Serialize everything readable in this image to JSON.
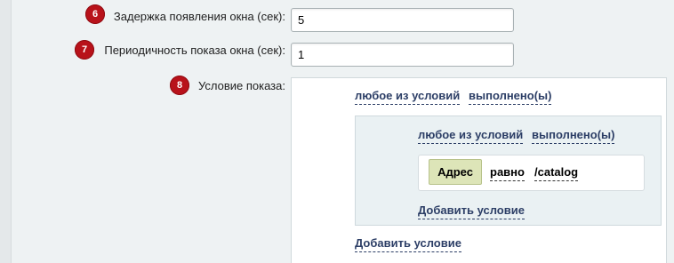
{
  "form": {
    "delay": {
      "badge": "6",
      "label": "Задержка появления окна (сек):",
      "value": "5"
    },
    "period": {
      "badge": "7",
      "label": "Периодичность показа окна (сек):",
      "value": "1"
    },
    "condition": {
      "badge": "8",
      "label": "Условие показа:"
    }
  },
  "condition_group": {
    "outer": {
      "any_label": "любое из условий",
      "met_label": "выполнено(ы)",
      "add_label": "Добавить условие"
    },
    "inner": {
      "any_label": "любое из условий",
      "met_label": "выполнено(ы)",
      "add_label": "Добавить условие"
    },
    "rule": {
      "field": "Адрес",
      "operator": "равно",
      "value": "/catalog"
    }
  },
  "colors": {
    "badge": "#b8121a",
    "link": "#2c3e66",
    "field_button": "#dde5b8"
  }
}
